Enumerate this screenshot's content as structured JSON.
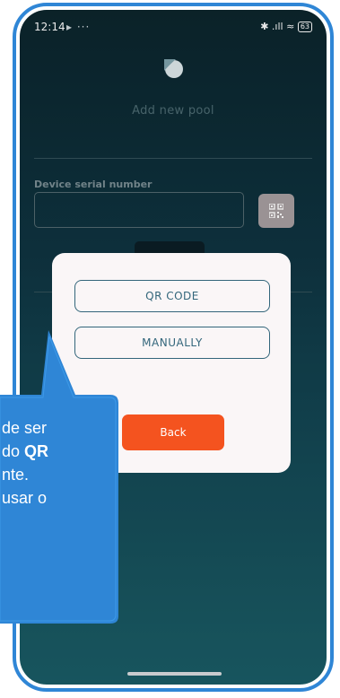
{
  "status_bar": {
    "time": "12:14",
    "extra_indicators": "▸ ···",
    "signal_icons": "✱ .ıll ≈",
    "battery": "63"
  },
  "header": {
    "title": "Add new pool"
  },
  "form": {
    "serial_label": "Device serial number",
    "serial_value": "",
    "serial_placeholder": ""
  },
  "modal": {
    "qr_code_label": "QR CODE",
    "manually_label": "MANUALLY",
    "back_label": "Back"
  },
  "callout": {
    "line1": "de ser",
    "line2_prefix": "do ",
    "line2_bold": "QR",
    "line3": "nte.",
    "line4": "usar o"
  },
  "colors": {
    "accent_orange": "#f4531f",
    "modal_bg": "#faf6f7",
    "button_outline": "#33667b",
    "callout_bg": "#2f86d6",
    "frame": "#2f86d6"
  }
}
